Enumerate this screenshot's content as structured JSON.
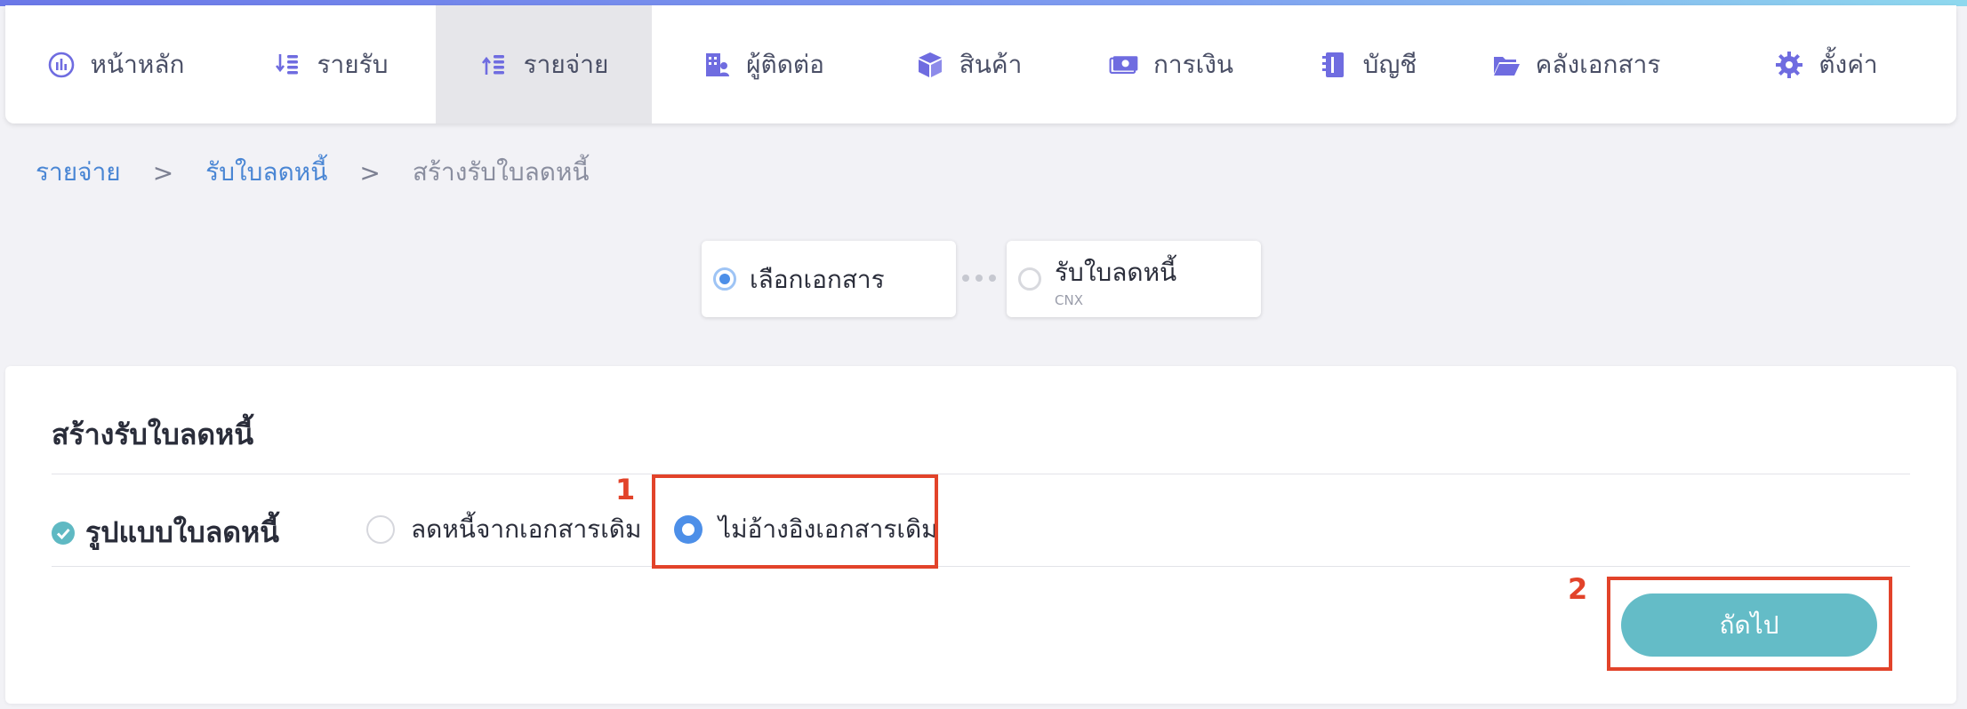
{
  "nav": {
    "items": [
      {
        "label": "หน้าหลัก",
        "icon": "dashboard-chart-icon"
      },
      {
        "label": "รายรับ",
        "icon": "income-sort-icon"
      },
      {
        "label": "รายจ่าย",
        "icon": "expense-sort-icon"
      },
      {
        "label": "ผู้ติดต่อ",
        "icon": "contacts-building-icon"
      },
      {
        "label": "สินค้า",
        "icon": "product-box-icon"
      },
      {
        "label": "การเงิน",
        "icon": "money-bill-icon"
      },
      {
        "label": "บัญชี",
        "icon": "ledger-book-icon"
      },
      {
        "label": "คลังเอกสาร",
        "icon": "folder-icon"
      },
      {
        "label": "ตั้งค่า",
        "icon": "gear-icon"
      }
    ],
    "active_index": 2
  },
  "breadcrumb": {
    "level1": "รายจ่าย",
    "level2": "รับใบลดหนี้",
    "current": "สร้างรับใบลดหนี้",
    "separator": ">"
  },
  "steps": [
    {
      "label": "เลือกเอกสาร",
      "sub": "",
      "active": true
    },
    {
      "label": "รับใบลดหนี้",
      "sub": "CNX",
      "active": false
    }
  ],
  "form": {
    "title": "สร้างรับใบลดหนี้",
    "field_label": "รูปแบบใบลดหนี้",
    "options": [
      {
        "label": "ลดหนี้จากเอกสารเดิม",
        "checked": false
      },
      {
        "label": "ไม่อ้างอิงเอกสารเดิม",
        "checked": true
      }
    ],
    "next_label": "ถัดไป"
  },
  "annotations": {
    "one": "1",
    "two": "2"
  },
  "colors": {
    "accent_blue": "#4d8fe8",
    "link_blue": "#4a86d4",
    "teal_button": "#64bcc7",
    "annotation_red": "#e2432a",
    "nav_active_bg": "#e6e6ea"
  }
}
